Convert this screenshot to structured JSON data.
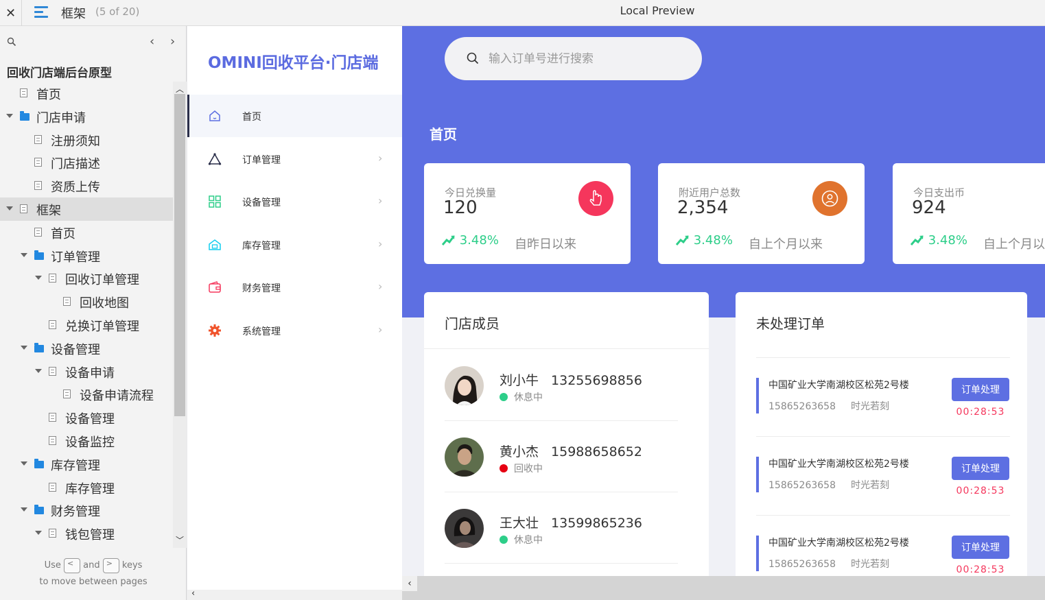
{
  "topbar": {
    "close": "✕",
    "title": "框架",
    "count": "(5 of 20)",
    "preview": "Local Preview"
  },
  "sitemap": {
    "prev": "‹",
    "next": "›",
    "root": "回收门店端后台原型",
    "items": [
      {
        "label": "首页",
        "type": "page",
        "indent": 0,
        "expand": false
      },
      {
        "label": "门店申请",
        "type": "folder",
        "indent": 0,
        "expand": true
      },
      {
        "label": "注册须知",
        "type": "page",
        "indent": 1,
        "expand": false
      },
      {
        "label": "门店描述",
        "type": "page",
        "indent": 1,
        "expand": false
      },
      {
        "label": "资质上传",
        "type": "page",
        "indent": 1,
        "expand": false
      },
      {
        "label": "框架",
        "type": "page",
        "indent": 0,
        "expand": true,
        "active": true
      },
      {
        "label": "首页",
        "type": "page",
        "indent": 1,
        "expand": false
      },
      {
        "label": "订单管理",
        "type": "folder",
        "indent": 1,
        "expand": true
      },
      {
        "label": "回收订单管理",
        "type": "page",
        "indent": 2,
        "expand": true
      },
      {
        "label": "回收地图",
        "type": "page",
        "indent": 3,
        "expand": false
      },
      {
        "label": "兑换订单管理",
        "type": "page",
        "indent": 2,
        "expand": false
      },
      {
        "label": "设备管理",
        "type": "folder",
        "indent": 1,
        "expand": true
      },
      {
        "label": "设备申请",
        "type": "page",
        "indent": 2,
        "expand": true
      },
      {
        "label": "设备申请流程",
        "type": "page",
        "indent": 3,
        "expand": false
      },
      {
        "label": "设备管理",
        "type": "page",
        "indent": 2,
        "expand": false
      },
      {
        "label": "设备监控",
        "type": "page",
        "indent": 2,
        "expand": false
      },
      {
        "label": "库存管理",
        "type": "folder",
        "indent": 1,
        "expand": true
      },
      {
        "label": "库存管理",
        "type": "page",
        "indent": 2,
        "expand": false
      },
      {
        "label": "财务管理",
        "type": "folder",
        "indent": 1,
        "expand": true
      },
      {
        "label": "钱包管理",
        "type": "page",
        "indent": 2,
        "expand": true
      }
    ],
    "hint_use": "Use",
    "hint_and": "and",
    "hint_keys": "keys",
    "hint_line2": "to move between pages",
    "key_prev": "<",
    "key_next": ">"
  },
  "app": {
    "brand": "OMINI回收平台·门店端",
    "nav": [
      {
        "label": "首页",
        "icon": "home-icon",
        "active": true,
        "chevron": false
      },
      {
        "label": "订单管理",
        "icon": "triangle-icon",
        "active": false,
        "chevron": true
      },
      {
        "label": "设备管理",
        "icon": "grid-icon",
        "active": false,
        "chevron": true
      },
      {
        "label": "库存管理",
        "icon": "warehouse-icon",
        "active": false,
        "chevron": true
      },
      {
        "label": "财务管理",
        "icon": "wallet-icon",
        "active": false,
        "chevron": true
      },
      {
        "label": "系统管理",
        "icon": "gear-icon",
        "active": false,
        "chevron": true
      }
    ],
    "chevron": "›"
  },
  "main": {
    "search_placeholder": "输入订单号进行搜索",
    "page_title": "首页",
    "stats": [
      {
        "label": "今日兑换量",
        "value": "120",
        "trend": "3.48%",
        "since": "自昨日以来",
        "badge_icon": "pointer-hand-icon",
        "badge_color": "#f5365c"
      },
      {
        "label": "附近用户总数",
        "value": "2,354",
        "trend": "3.48%",
        "since": "自上个月以来",
        "badge_icon": "user-circle-icon",
        "badge_color": "#e0732e"
      },
      {
        "label": "今日支出币",
        "value": "924",
        "trend": "3.48%",
        "since": "自上个月以来",
        "badge_icon": "",
        "badge_color": ""
      }
    ],
    "members_title": "门店成员",
    "members": [
      {
        "name": "刘小牛",
        "phone": "13255698856",
        "status": "休息中",
        "status_color": "#2dce89"
      },
      {
        "name": "黄小杰",
        "phone": "15988658652",
        "status": "回收中",
        "status_color": "#e60012"
      },
      {
        "name": "王大壮",
        "phone": "13599865236",
        "status": "休息中",
        "status_color": "#2dce89"
      }
    ],
    "orders_title": "未处理订单",
    "orders": [
      {
        "address": "中国矿业大学南湖校区松苑2号楼",
        "phone": "15865263658",
        "user": "时光若刻",
        "action": "订单处理",
        "timer": "00:28:53"
      },
      {
        "address": "中国矿业大学南湖校区松苑2号楼",
        "phone": "15865263658",
        "user": "时光若刻",
        "action": "订单处理",
        "timer": "00:28:53"
      },
      {
        "address": "中国矿业大学南湖校区松苑2号楼",
        "phone": "15865263658",
        "user": "时光若刻",
        "action": "订单处理",
        "timer": "00:28:53"
      }
    ]
  },
  "colors": {
    "accent": "#5d6fe2",
    "positive": "#2dce89",
    "danger": "#f5365c"
  }
}
